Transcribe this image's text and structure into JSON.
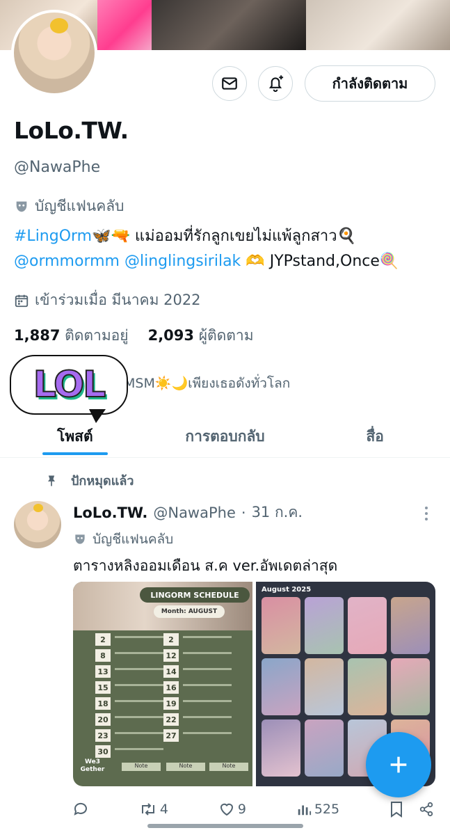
{
  "profile": {
    "display_name": "LoLo.TW.",
    "handle": "@NawaPhe",
    "account_label": "บัญชีแฟนคลับ",
    "bio_hashtag": "#LingOrm",
    "bio_line1_rest": "แม่ออมที่รักลูกเขยไม่แพ้ลูกสาว",
    "bio_mention1": "@ormmormm",
    "bio_mention2": "@linglingsirilak",
    "bio_line2_rest": "JYPstand,Once",
    "joined": "เข้าร่วมเมื่อ มีนาคม 2022",
    "following_count": "1,887",
    "following_label": "ติดตามอยู่",
    "followers_count": "2,093",
    "followers_label": "ผู้ติดตาม",
    "extra_line": "MSM☀️🌙เพียงเธอดังทั่วโลก",
    "follow_button": "กำลังติดตาม"
  },
  "sticker": {
    "text": "LOL"
  },
  "tabs": [
    {
      "label": "โพสต์",
      "active": true
    },
    {
      "label": "การตอบกลับ",
      "active": false
    },
    {
      "label": "สื่อ",
      "active": false
    }
  ],
  "post": {
    "pinned_label": "ปักหมุดแล้ว",
    "author_name": "LoLo.TW.",
    "author_handle": "@NawaPhe",
    "separator": "·",
    "date": "31 ก.ค.",
    "account_label": "บัญชีแฟนคลับ",
    "text": "ตารางหลิงออมเดือน ส.ค ver.อัพเดตล่าสุด",
    "image1": {
      "title": "LINGORM SCHEDULE",
      "month": "Month: AUGUST",
      "days": [
        "2",
        "8",
        "13",
        "15",
        "18",
        "20",
        "23",
        "30"
      ],
      "days_right": [
        "2",
        "12",
        "14",
        "16",
        "19",
        "22",
        "27"
      ],
      "footer_logo": "We3 Gether",
      "notes": [
        "Note",
        "Note",
        "Note"
      ]
    },
    "image2": {
      "heading": "August 2025"
    },
    "stats": {
      "retweets": "4",
      "likes": "9",
      "views": "525"
    }
  },
  "colors": {
    "accent": "#1d9bf0",
    "text": "#0f1419",
    "muted": "#536471",
    "schedule_green": "#5d6b4f"
  }
}
